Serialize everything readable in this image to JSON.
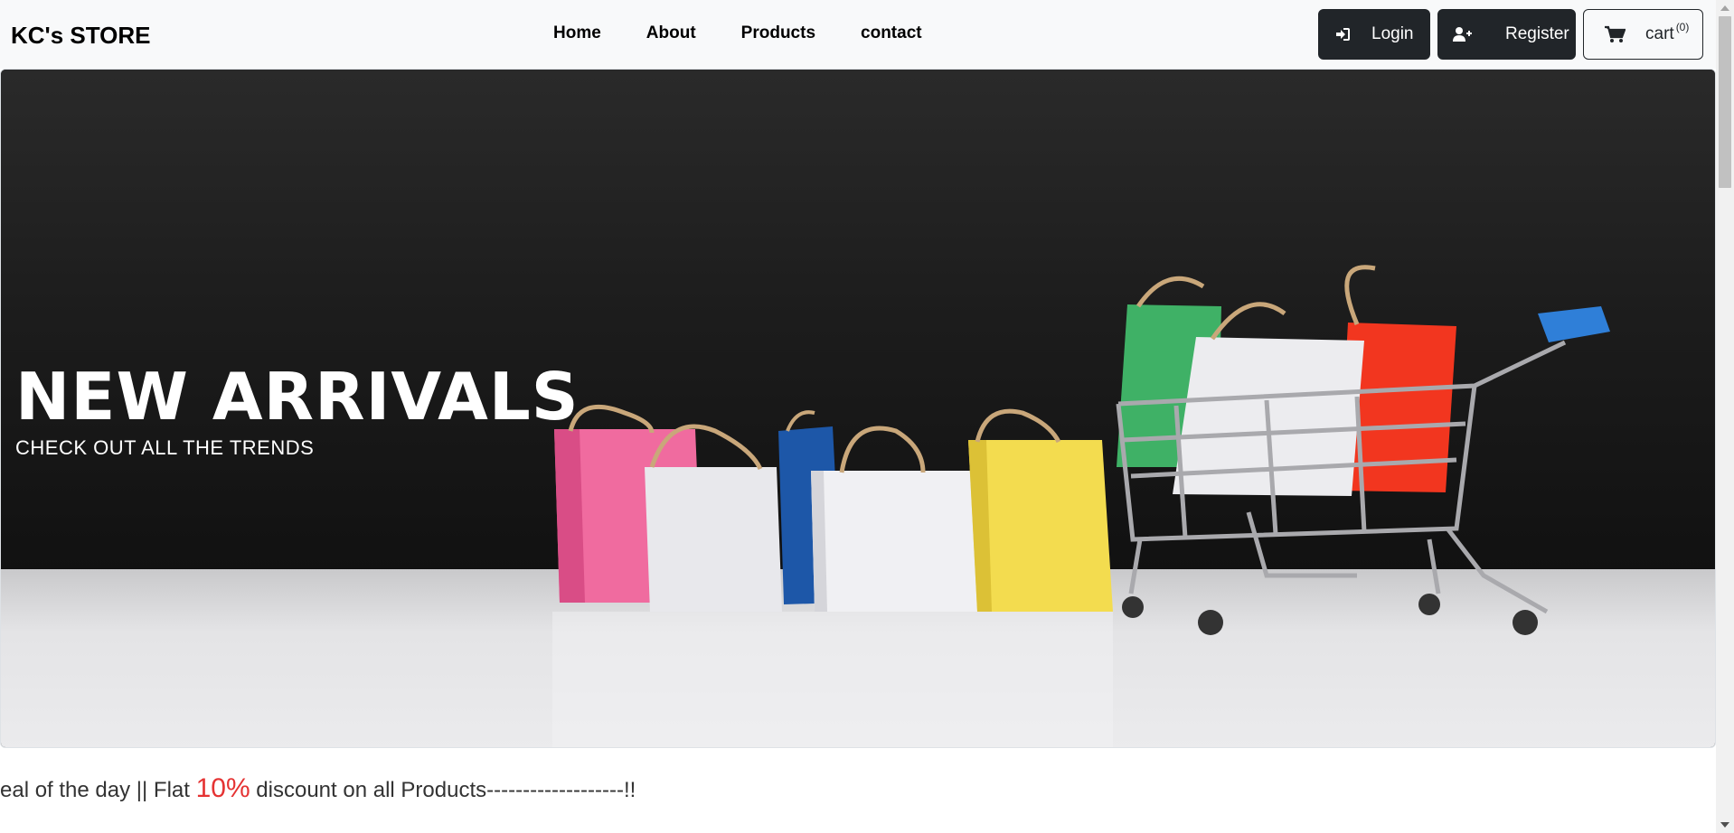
{
  "navbar": {
    "brand": "KC's STORE",
    "links": [
      "Home",
      "About",
      "Products",
      "contact"
    ],
    "login_label": "Login",
    "register_label": "Register",
    "cart_label": "cart",
    "cart_count": "(0)"
  },
  "hero": {
    "title": "NEW ARRIVALS",
    "subtitle": "CHECK OUT ALL THE TRENDS"
  },
  "marquee": {
    "prefix": "eal of the day || Flat ",
    "highlight": "10%",
    "suffix": " discount on all Products-------------------!!"
  },
  "colors": {
    "navbar_bg": "#f8f9fa",
    "button_dark": "#212529",
    "highlight": "#e53333"
  },
  "icons": {
    "login": "sign-in-icon",
    "register": "user-plus-icon",
    "cart": "shopping-cart-icon"
  }
}
